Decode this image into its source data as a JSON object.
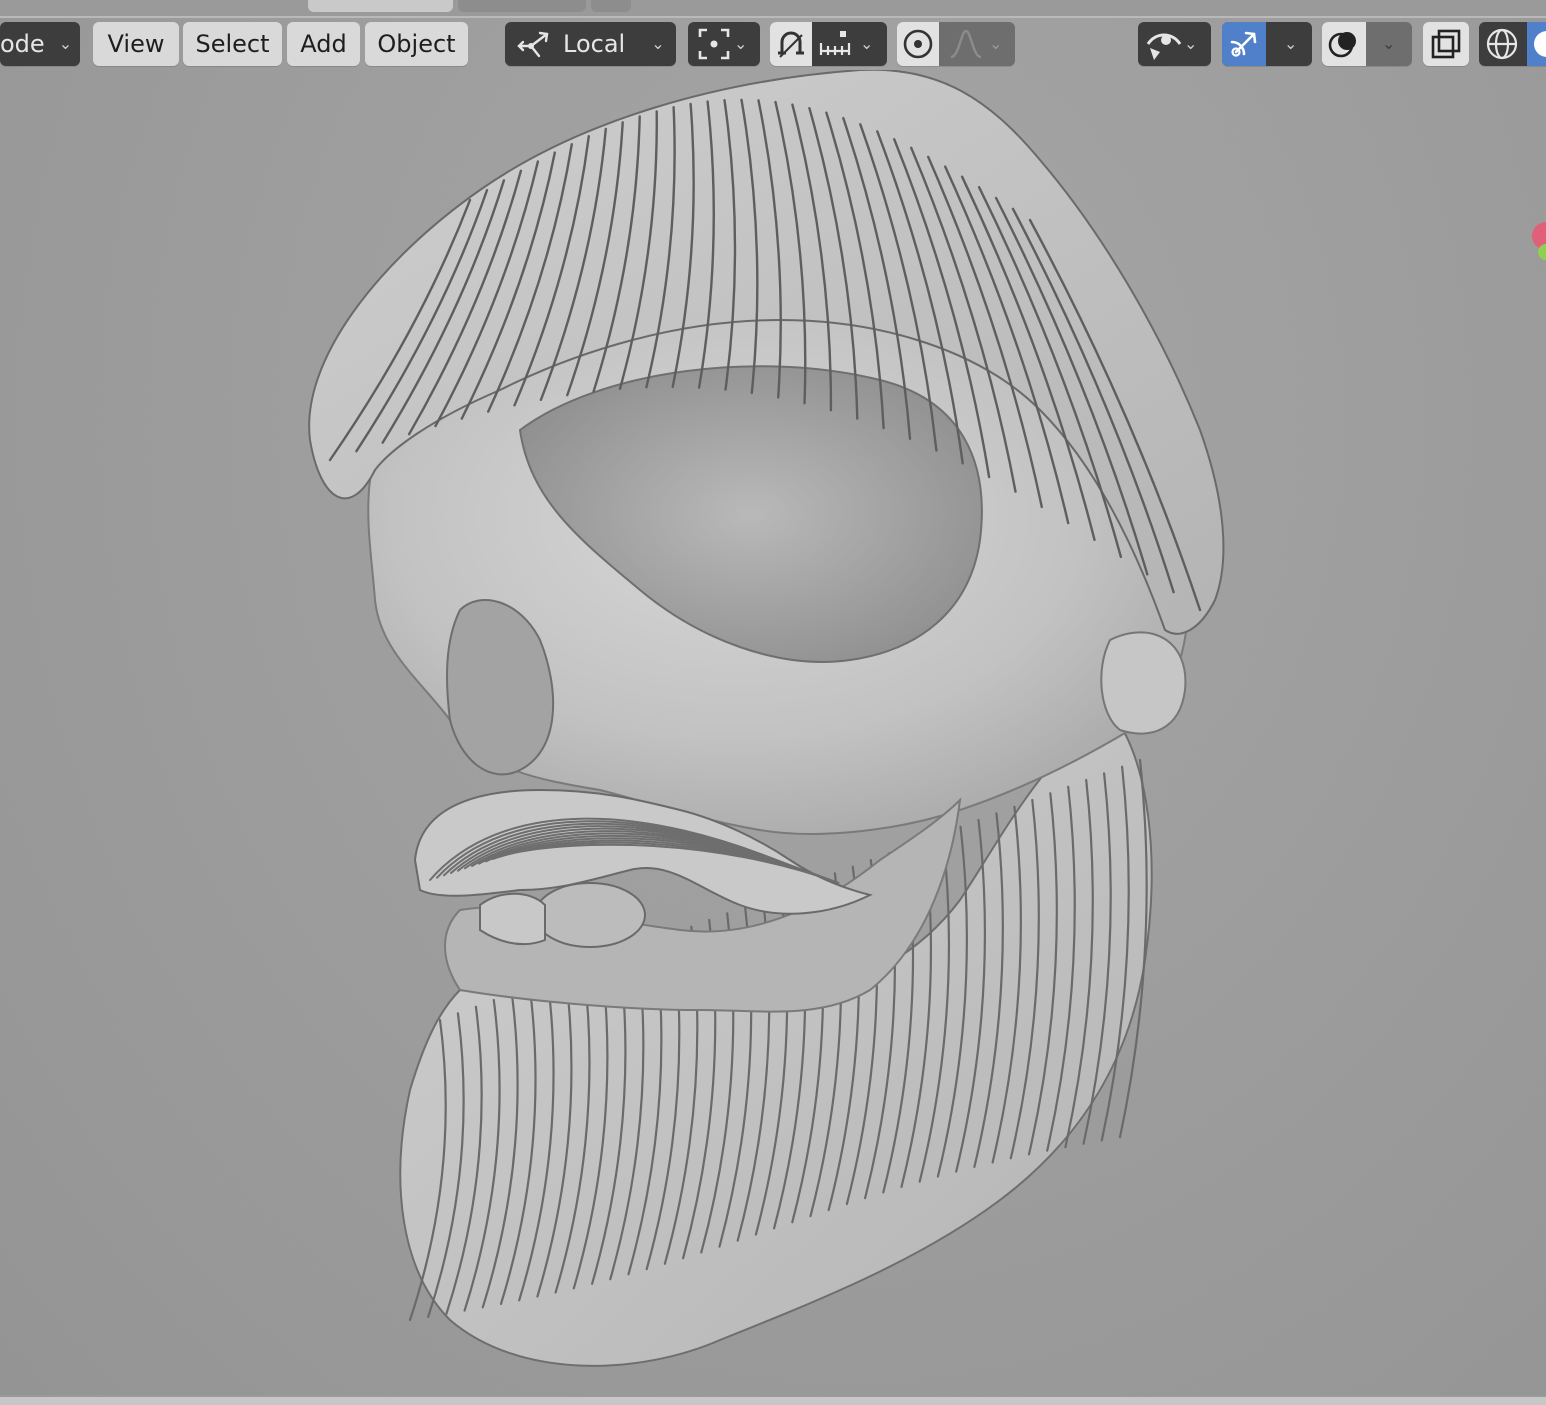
{
  "header": {
    "mode_label": "ode",
    "menu": [
      "View",
      "Select",
      "Add",
      "Object"
    ],
    "transform_orientation": "Local"
  },
  "icons": {
    "orientation": "transform-orientation-icon",
    "pivot": "pivot-point-icon",
    "snap": "snap-magnet-icon",
    "snap_increment": "snap-increment-icon",
    "proportional": "proportional-editing-icon",
    "falloff": "falloff-curve-icon",
    "visibility": "object-visibility-icon",
    "gizmo": "gizmo-icon",
    "overlays": "overlays-icon",
    "xray": "xray-icon",
    "wireframe": "wireframe-shading-icon",
    "solid": "solid-shading-icon"
  },
  "colors": {
    "selected_toggle": "#4f80c9",
    "viewport_bg": "#9c9c9c",
    "model": "#c4c4c4"
  }
}
